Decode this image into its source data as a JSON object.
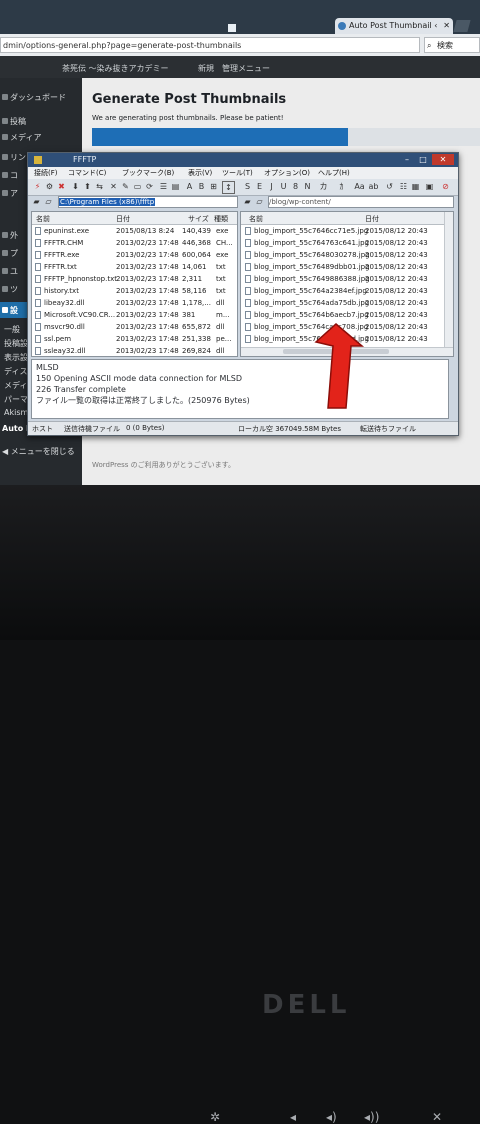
{
  "browser": {
    "tab_title": "Auto Post Thumbnail ‹",
    "url": "dmin/options-general.php?page=generate-post-thumbnails",
    "search_placeholder": "検索"
  },
  "wp": {
    "adminbar": {
      "site": "茶筅伝 〜染み抜きアカデミー",
      "new": "新規",
      "menu": "管理メニュー"
    },
    "menu_items": [
      "ダッシュボード",
      "投稿",
      "メディア",
      "リン",
      "コ",
      "ア",
      "外",
      "プ",
      "ユ",
      "ツ",
      "設",
      "一般",
      "投稿設定",
      "表示設定",
      "ディスカ",
      "メディア",
      "パーマ",
      "Akisme",
      "Auto Post Thumbnail"
    ],
    "collapse_label": "メニューを閉じる",
    "page_title": "Generate Post Thumbnails",
    "page_desc": "We are generating post thumbnails. Please be patient!",
    "progress": 0.66,
    "footer": "WordPress のご利用ありがとうございます。"
  },
  "ffftp": {
    "title": "FFFTP",
    "menu": [
      "接続(F)",
      "コマンド(C)",
      "ブックマーク(B)",
      "表示(V)",
      "ツール(T)",
      "オプション(O)",
      "ヘルプ(H)"
    ],
    "local_path": "C:\\Program Files (x86)\\ffftp",
    "remote_path": "/blog/wp-content/",
    "local_headers": {
      "name": "名前",
      "date": "日付",
      "size": "サイズ",
      "type": "種類"
    },
    "remote_headers": {
      "name": "名前",
      "date": "日付"
    },
    "local_files": [
      {
        "name": "epuninst.exe",
        "date": "2015/08/13  8:24",
        "size": "140,439",
        "type": "exe"
      },
      {
        "name": "FFFTR.CHM",
        "date": "2013/02/23 17:48",
        "size": "446,368",
        "type": "CH..."
      },
      {
        "name": "FFFTR.exe",
        "date": "2013/02/23 17:48",
        "size": "600,064",
        "type": "exe"
      },
      {
        "name": "FFFTR.txt",
        "date": "2013/02/23 17:48",
        "size": "14,061",
        "type": "txt"
      },
      {
        "name": "FFFTP_hpnonstop.txt",
        "date": "2013/02/23 17:48",
        "size": "2,311",
        "type": "txt"
      },
      {
        "name": "history.txt",
        "date": "2013/02/23 17:48",
        "size": "58,116",
        "type": "txt"
      },
      {
        "name": "libeay32.dll",
        "date": "2013/02/23 17:48",
        "size": "1,178,...",
        "type": "dll"
      },
      {
        "name": "Microsoft.VC90.CR...",
        "date": "2013/02/23 17:48",
        "size": "381",
        "type": "m..."
      },
      {
        "name": "msvcr90.dll",
        "date": "2013/02/23 17:48",
        "size": "655,872",
        "type": "dll"
      },
      {
        "name": "ssl.pem",
        "date": "2013/02/23 17:48",
        "size": "251,338",
        "type": "pe..."
      },
      {
        "name": "ssleay32.dll",
        "date": "2013/02/23 17:48",
        "size": "269,824",
        "type": "dll"
      }
    ],
    "remote_files": [
      {
        "name": "blog_import_55c7646cc71e5.jpg",
        "date": "2015/08/12 20:43"
      },
      {
        "name": "blog_import_55c764763c641.jpg",
        "date": "2015/08/12 20:43"
      },
      {
        "name": "blog_import_55c7648030278.jpg",
        "date": "2015/08/12 20:43"
      },
      {
        "name": "blog_import_55c76489dbb01.jpg",
        "date": "2015/08/12 20:43"
      },
      {
        "name": "blog_import_55c7649886388.jpg",
        "date": "2015/08/12 20:43"
      },
      {
        "name": "blog_import_55c764a2384ef.jpg",
        "date": "2015/08/12 20:43"
      },
      {
        "name": "blog_import_55c764ada75db.jpg",
        "date": "2015/08/12 20:43"
      },
      {
        "name": "blog_import_55c764b6aecb7.jpg",
        "date": "2015/08/12 20:43"
      },
      {
        "name": "blog_import_55c764ca0c708.jpg",
        "date": "2015/08/12 20:43"
      },
      {
        "name": "blog_import_55c764dd22c7d.jpg",
        "date": "2015/08/12 20:43"
      }
    ],
    "log": [
      "MLSD",
      "150 Opening ASCII mode data connection for MLSD",
      "226 Transfer complete",
      "ファイル一覧の取得は正常終了しました。(250976 Bytes)"
    ],
    "status": {
      "host": "ホスト",
      "queue": "送信待機ファイル",
      "bytes": "0 (0 Bytes)",
      "local": "ローカル空 367049.58M Bytes",
      "transfer": "転送待ちファイル"
    }
  },
  "colors": {
    "arrow": "#e2231a",
    "wp_blue": "#1e6eb6",
    "ffftp_title": "#2f4f78"
  }
}
